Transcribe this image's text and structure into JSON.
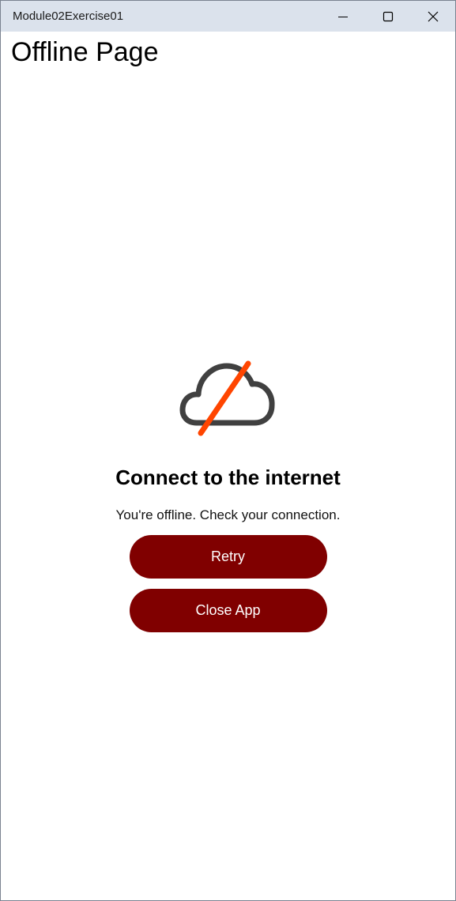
{
  "window": {
    "title": "Module02Exercise01",
    "controls": {
      "minimize_icon": "minimize-icon",
      "maximize_icon": "maximize-icon",
      "close_icon": "close-icon"
    }
  },
  "page": {
    "title": "Offline Page"
  },
  "offline": {
    "icon": "cloud-offline-icon",
    "heading": "Connect to the internet",
    "message": "You're offline. Check your connection.",
    "retry_label": "Retry",
    "close_app_label": "Close App"
  },
  "colors": {
    "titlebar": "#dbe2ec",
    "button_bg": "#800000",
    "button_text": "#ffffff",
    "cloud": "#404040",
    "slash": "#ff4500"
  }
}
